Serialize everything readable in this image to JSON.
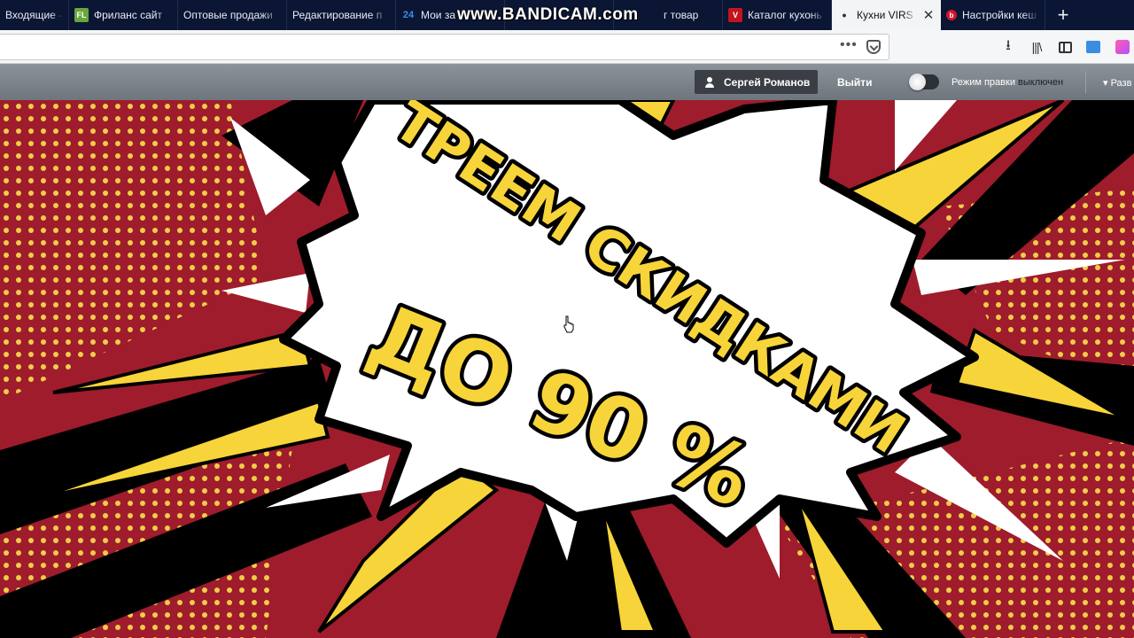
{
  "browser": {
    "tabs": [
      {
        "label": "Входящие –",
        "favicon": "",
        "active": false
      },
      {
        "label": "Фриланс сайт",
        "favicon": "FL",
        "active": false
      },
      {
        "label": "Оптовые продажи",
        "favicon": "",
        "active": false
      },
      {
        "label": "Редактирование п",
        "favicon": "",
        "active": false
      },
      {
        "label": "Мои за",
        "favicon": "24",
        "active": false
      },
      {
        "label": "",
        "favicon": "",
        "active": false
      },
      {
        "label": "г товар",
        "favicon": "",
        "active": false
      },
      {
        "label": "Каталог кухонь",
        "favicon": "V",
        "active": false
      },
      {
        "label": "Кухни VIRS",
        "favicon": "•",
        "active": true
      },
      {
        "label": "Настройки кеш",
        "favicon": "b",
        "active": false
      }
    ],
    "new_tab_icon": "plus-icon",
    "url_more_icon": "•••",
    "toolbar_icons": [
      "download-icon",
      "library-icon",
      "sidebar-icon",
      "sync-icon",
      "extension-icon"
    ],
    "download_glyph": "⭳",
    "library_glyph": "|||\\"
  },
  "watermark": "www.BANDICAM.com",
  "admin_bar": {
    "user_name": "Сергей Романов",
    "logout_label": "Выйти",
    "edit_mode_label": "Режим правки",
    "edit_mode_state": "выключен",
    "expand_label": "Разв"
  },
  "banner": {
    "line1": "ТРЕЕМ СКИДКАМИ",
    "line2": "ДО 90 %",
    "colors": {
      "background": "#9e1c2c",
      "burst": "#ffffff",
      "text": "#f7d43a",
      "outline": "#000000",
      "ray_yellow": "#f7d43a"
    }
  }
}
